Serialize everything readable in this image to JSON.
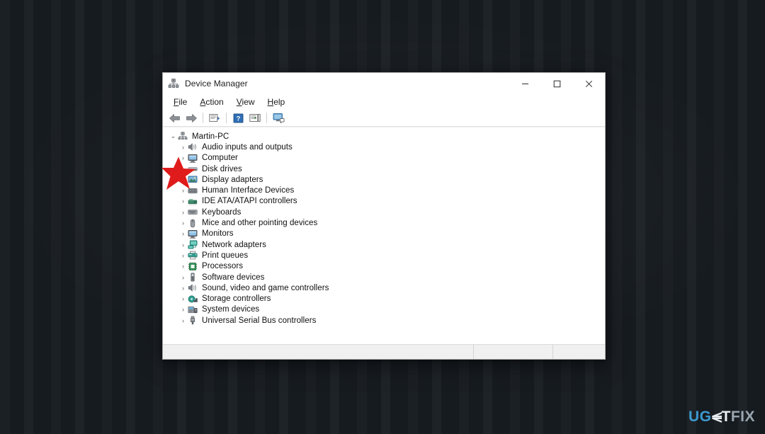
{
  "window": {
    "title": "Device Manager",
    "title_icon": "device-manager-icon",
    "controls": {
      "minimize": "—",
      "maximize": "□",
      "close": "✕"
    }
  },
  "menubar": [
    {
      "name": "file",
      "label": "File",
      "accel": "F"
    },
    {
      "name": "action",
      "label": "Action",
      "accel": "A"
    },
    {
      "name": "view",
      "label": "View",
      "accel": "V"
    },
    {
      "name": "help",
      "label": "Help",
      "accel": "H"
    }
  ],
  "toolbar": [
    {
      "name": "back-button",
      "icon": "back-arrow-icon"
    },
    {
      "name": "forward-button",
      "icon": "forward-arrow-icon"
    },
    {
      "name": "separator-1",
      "icon": "separator"
    },
    {
      "name": "properties-button",
      "icon": "properties-icon"
    },
    {
      "name": "separator-2",
      "icon": "separator"
    },
    {
      "name": "help-button",
      "icon": "help-question-icon"
    },
    {
      "name": "show-hidden-button",
      "icon": "show-hidden-devices-icon"
    },
    {
      "name": "separator-3",
      "icon": "separator"
    },
    {
      "name": "scan-hardware-button",
      "icon": "scan-for-hardware-changes-icon"
    }
  ],
  "tree": {
    "root": {
      "label": "Martin-PC",
      "icon": "computer-root-icon",
      "expanded": true,
      "chevron": "⌄"
    },
    "items": [
      {
        "label": "Audio inputs and outputs",
        "icon": "speaker-icon",
        "chevron": "›"
      },
      {
        "label": "Computer",
        "icon": "monitor-icon",
        "chevron": "›"
      },
      {
        "label": "Disk drives",
        "icon": "disk-drive-icon",
        "chevron": "›"
      },
      {
        "label": "Display adapters",
        "icon": "display-adapter-icon",
        "chevron": "›"
      },
      {
        "label": "Human Interface Devices",
        "icon": "hid-icon",
        "chevron": "›"
      },
      {
        "label": "IDE ATA/ATAPI controllers",
        "icon": "ide-controller-icon",
        "chevron": "›"
      },
      {
        "label": "Keyboards",
        "icon": "keyboard-icon",
        "chevron": "›"
      },
      {
        "label": "Mice and other pointing devices",
        "icon": "mouse-icon",
        "chevron": "›"
      },
      {
        "label": "Monitors",
        "icon": "monitor-icon",
        "chevron": "›"
      },
      {
        "label": "Network adapters",
        "icon": "network-adapter-icon",
        "chevron": "›"
      },
      {
        "label": "Print queues",
        "icon": "printer-icon",
        "chevron": "›"
      },
      {
        "label": "Processors",
        "icon": "processor-icon",
        "chevron": "›"
      },
      {
        "label": "Software devices",
        "icon": "software-device-icon",
        "chevron": "›"
      },
      {
        "label": "Sound, video and game controllers",
        "icon": "speaker-icon",
        "chevron": "›"
      },
      {
        "label": "Storage controllers",
        "icon": "storage-controller-icon",
        "chevron": "›"
      },
      {
        "label": "System devices",
        "icon": "system-device-icon",
        "chevron": "›"
      },
      {
        "label": "Universal Serial Bus controllers",
        "icon": "usb-icon",
        "chevron": "›"
      }
    ]
  },
  "statusbar": {
    "pane1": "",
    "pane2": "",
    "pane3": ""
  },
  "annotation": {
    "name": "red-star-marker",
    "points_at": "Display adapters",
    "color": "#e01b1b"
  },
  "watermark": {
    "part1": "UG",
    "part2": "E",
    "part3": "T",
    "part4": "FIX",
    "color_primary": "#3d9ad1",
    "color_secondary": "#9aa7b0"
  }
}
